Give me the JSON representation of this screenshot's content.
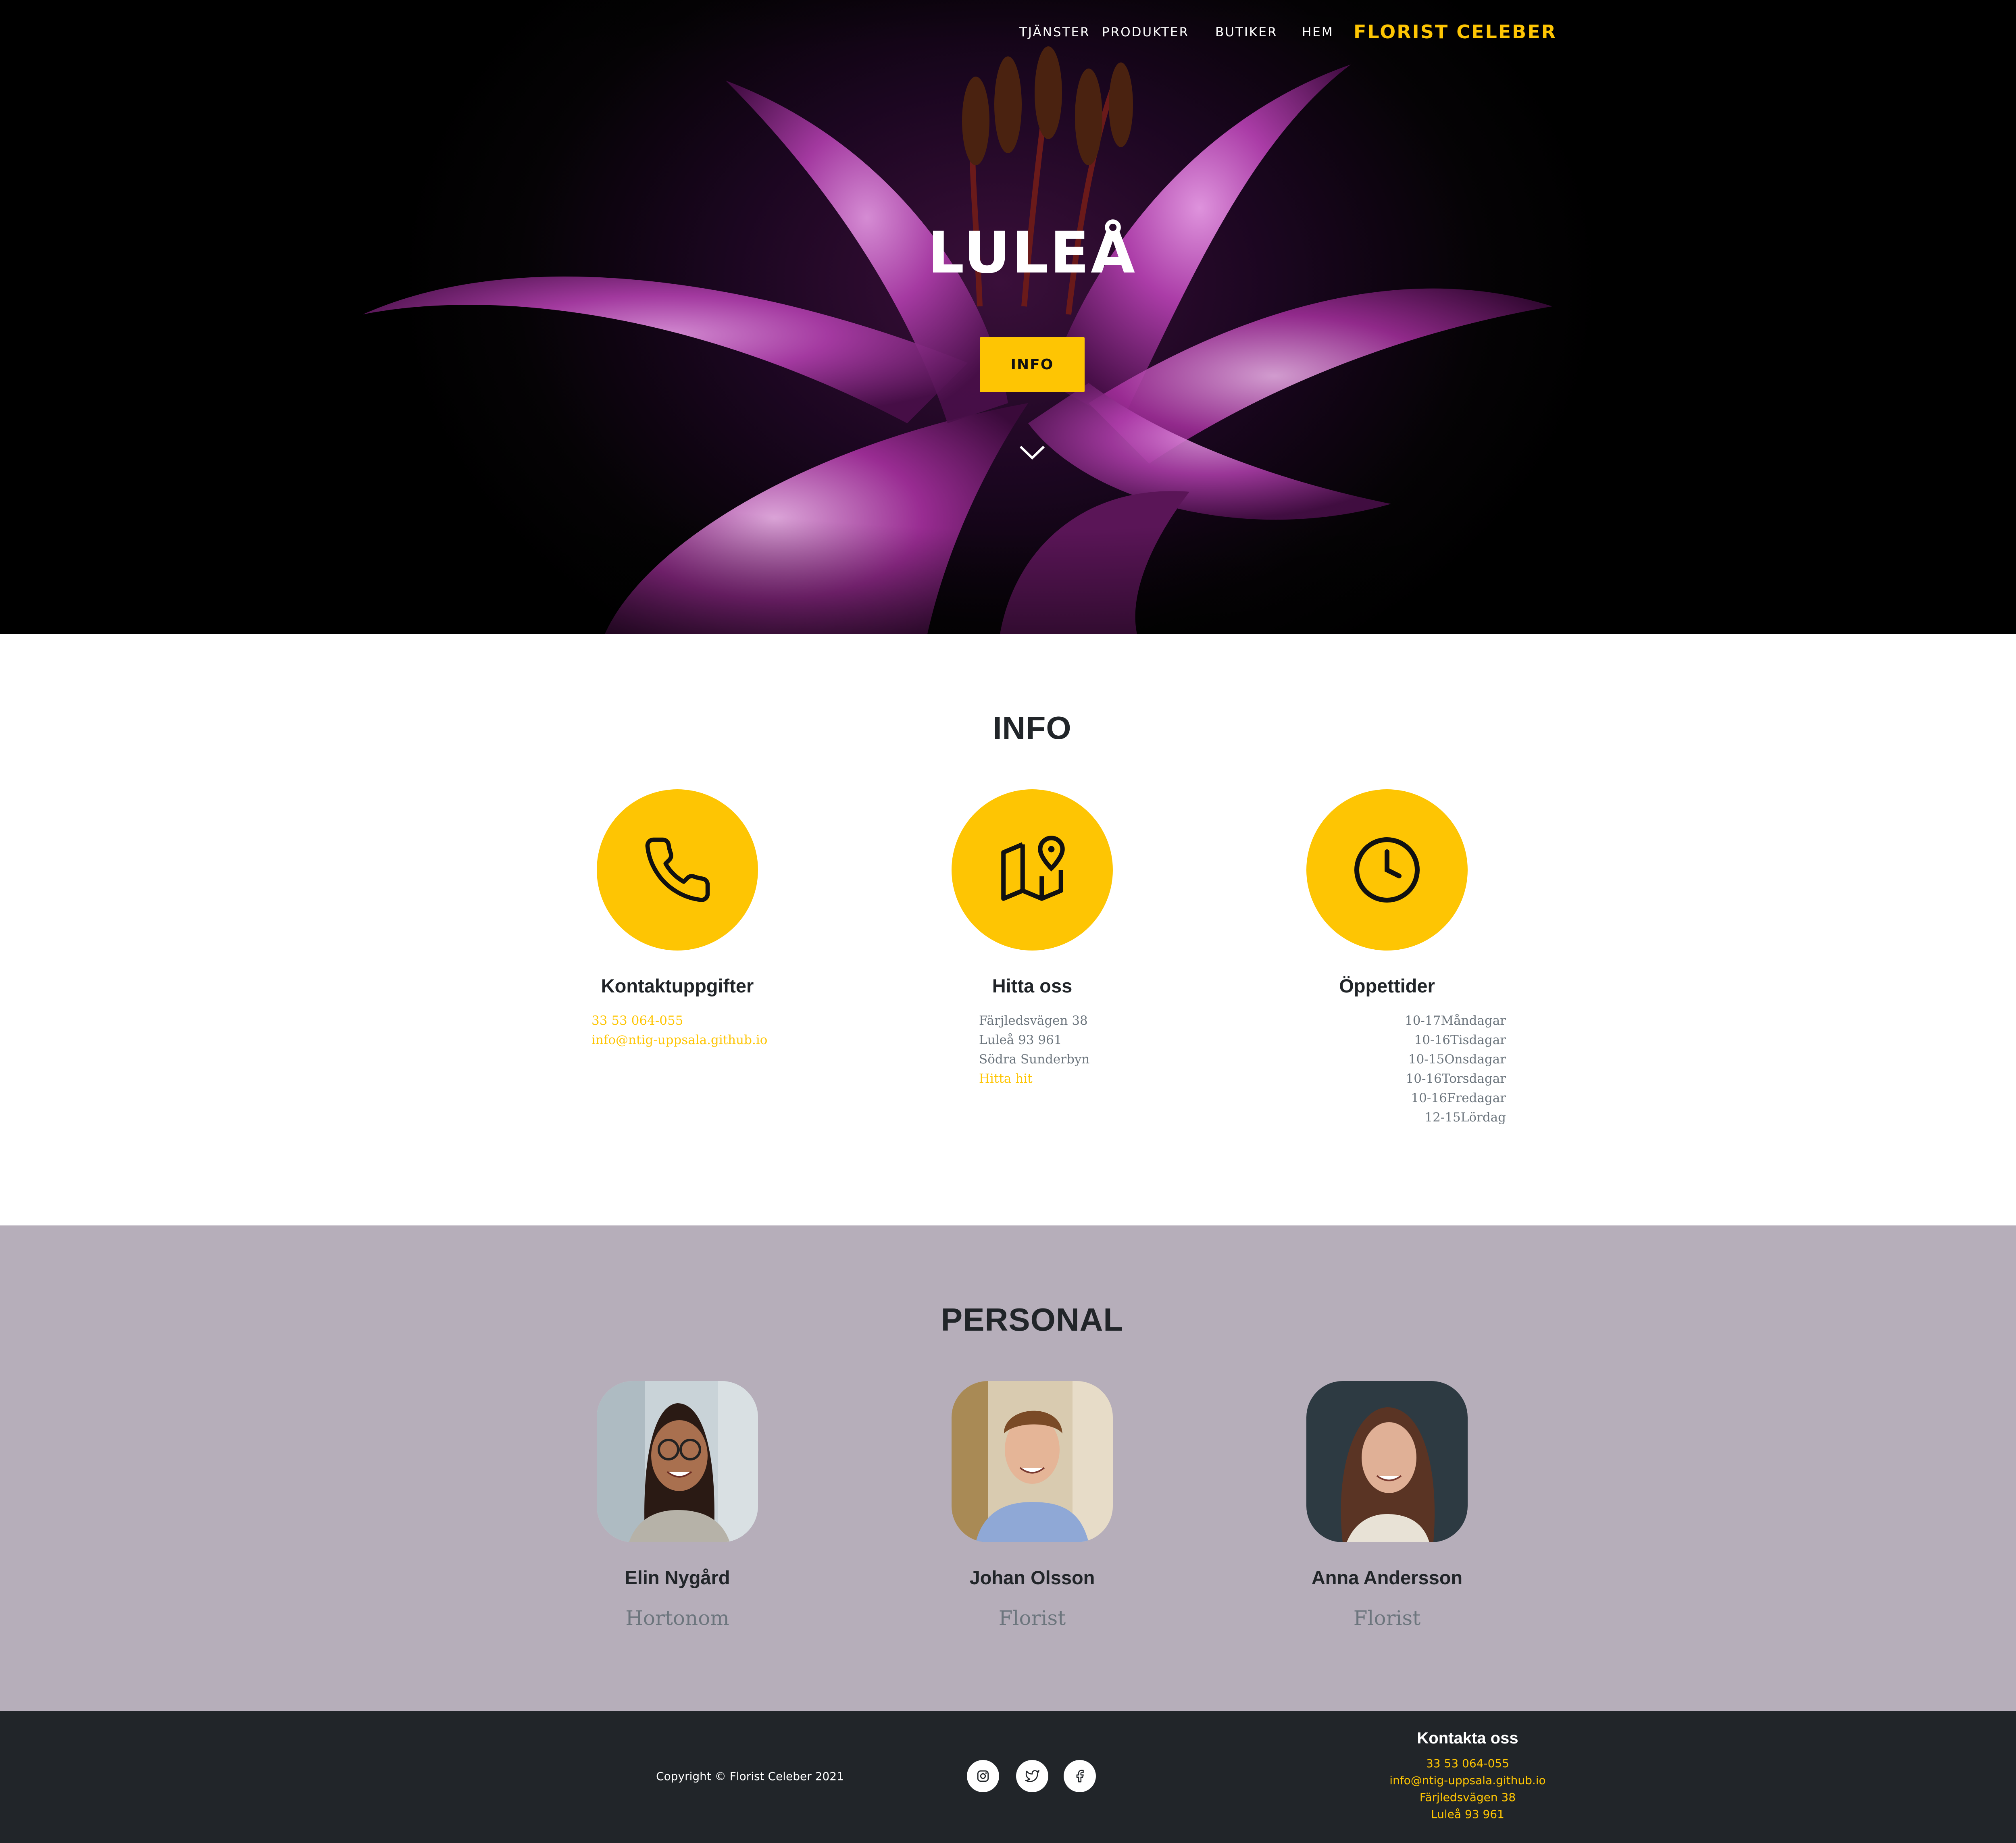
{
  "nav": {
    "links": [
      "TJÄNSTER",
      "PRODUKTER",
      "BUTIKER",
      "HEM"
    ],
    "brand": "FLORIST CELEBER"
  },
  "hero": {
    "title": "LULEÅ",
    "button_label": "INFO"
  },
  "info": {
    "title": "INFO",
    "contact": {
      "title": "Kontaktuppgifter",
      "phone": "33 53 064-055",
      "email": "info@ntig-uppsala.github.io"
    },
    "find": {
      "title": "Hitta oss",
      "lines": [
        "Färjledsvägen 38",
        "Luleå 93 961",
        "Södra Sunderbyn"
      ],
      "link": "Hitta hit"
    },
    "hours": {
      "title": "Öppettider",
      "rows": [
        "10-17Måndagar",
        "10-16Tisdagar",
        "10-15Onsdagar",
        "10-16Torsdagar",
        "10-16Fredagar",
        "12-15Lördag"
      ]
    }
  },
  "personal": {
    "title": "PERSONAL",
    "people": [
      {
        "name": "Elin Nygård",
        "role": "Hortonom"
      },
      {
        "name": "Johan Olsson",
        "role": "Florist"
      },
      {
        "name": "Anna Andersson",
        "role": "Florist"
      }
    ]
  },
  "footer": {
    "copyright": "Copyright © Florist Celeber 2021",
    "contact_title": "Kontakta oss",
    "contact_lines": [
      "33 53 064-055",
      "info@ntig-uppsala.github.io",
      "Färjledsvägen 38",
      "Luleå 93 961"
    ]
  },
  "colors": {
    "accent": "#fec503",
    "dark": "#212529",
    "personal_bg": "#b6aeba",
    "muted": "#6c757d"
  },
  "icons": [
    "phone-icon",
    "map-pin-icon",
    "clock-icon",
    "instagram-icon",
    "twitter-icon",
    "facebook-icon",
    "chevron-down-icon"
  ]
}
